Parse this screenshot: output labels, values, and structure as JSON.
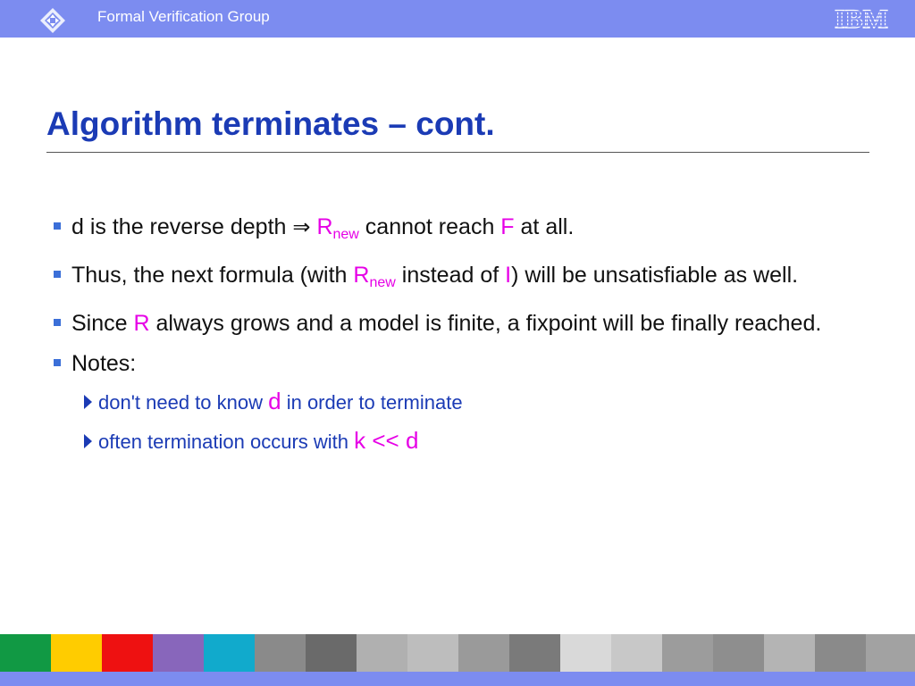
{
  "header": {
    "group_name": "Formal Verification Group",
    "brand_logo": "IBM"
  },
  "slide": {
    "title": "Algorithm terminates – cont."
  },
  "bullets": {
    "b1": {
      "t1": "d is the reverse depth ",
      "arrow": "⇒",
      "t2": " ",
      "r": "R",
      "sub": "new",
      "t3": " cannot reach ",
      "f": "F",
      "t4": " at all."
    },
    "b2": {
      "t1": "Thus, the next formula (with ",
      "r": "R",
      "sub": "new",
      "t2": " instead of ",
      "i": "I",
      "t3": ")  will be unsatisfiable as well."
    },
    "b3": {
      "t1": "Since ",
      "r": "R",
      "t2": " always grows  and a model is finite,  a fixpoint will be finally reached."
    },
    "b4": {
      "t1": "Notes:"
    }
  },
  "subbullets": {
    "s1": {
      "t1": "don't need to know ",
      "d": "d",
      "t2": " in order to terminate"
    },
    "s2": {
      "t1": "often termination occurs with ",
      "k": "k << d"
    }
  },
  "colors": {
    "header_bar": "#7c8cf0",
    "title": "#1b3bb5",
    "highlight": "#e600e6",
    "bullet_marker": "#3b6fd8"
  },
  "footer": {
    "tiles": [
      "#119944",
      "#ffcc00",
      "#ee1111",
      "#8866bb",
      "#11aacc",
      "#8a8a8a",
      "#6a6a6a",
      "#b0b0b0",
      "#bdbdbd",
      "#9a9a9a",
      "#7a7a7a",
      "#d9d9d9",
      "#c8c8c8",
      "#9c9c9c",
      "#8e8e8e",
      "#b4b4b4",
      "#8a8a8a",
      "#a2a2a2"
    ]
  }
}
